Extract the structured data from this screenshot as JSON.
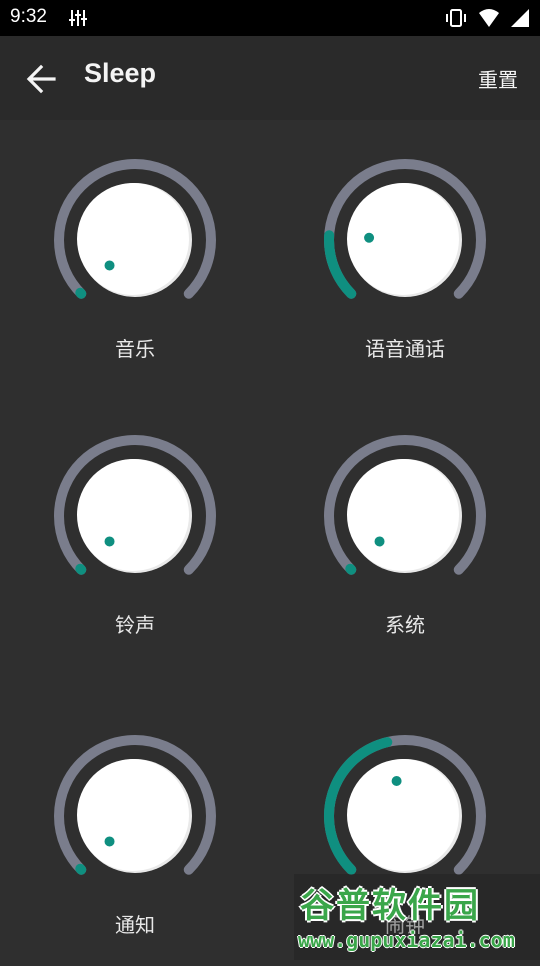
{
  "status_bar": {
    "time": "9:32",
    "icons": [
      "equalizer-icon",
      "vibrate-icon",
      "wifi-icon",
      "cell-signal-icon"
    ]
  },
  "app_bar": {
    "title": "Sleep",
    "back_icon": "arrow-left-icon",
    "reset_label": "重置"
  },
  "colors": {
    "track": "#7a7d8c",
    "active": "#0f8f80",
    "knob": "#ffffff",
    "dot": "#0f8f80",
    "background": "#2f2f2f",
    "app_bar": "#2a2a2a"
  },
  "knobs": [
    {
      "id": "music",
      "label": "音乐",
      "level": 0.0
    },
    {
      "id": "voice-call",
      "label": "语音通话",
      "level": 0.18
    },
    {
      "id": "ringtone",
      "label": "铃声",
      "level": 0.0
    },
    {
      "id": "system",
      "label": "系统",
      "level": 0.0
    },
    {
      "id": "notification",
      "label": "通知",
      "level": 0.0
    },
    {
      "id": "alarm",
      "label": "闹钟",
      "level": 0.45
    }
  ],
  "watermark": {
    "logo": "谷普软件园",
    "url": "www.gupuxiazai.com"
  }
}
